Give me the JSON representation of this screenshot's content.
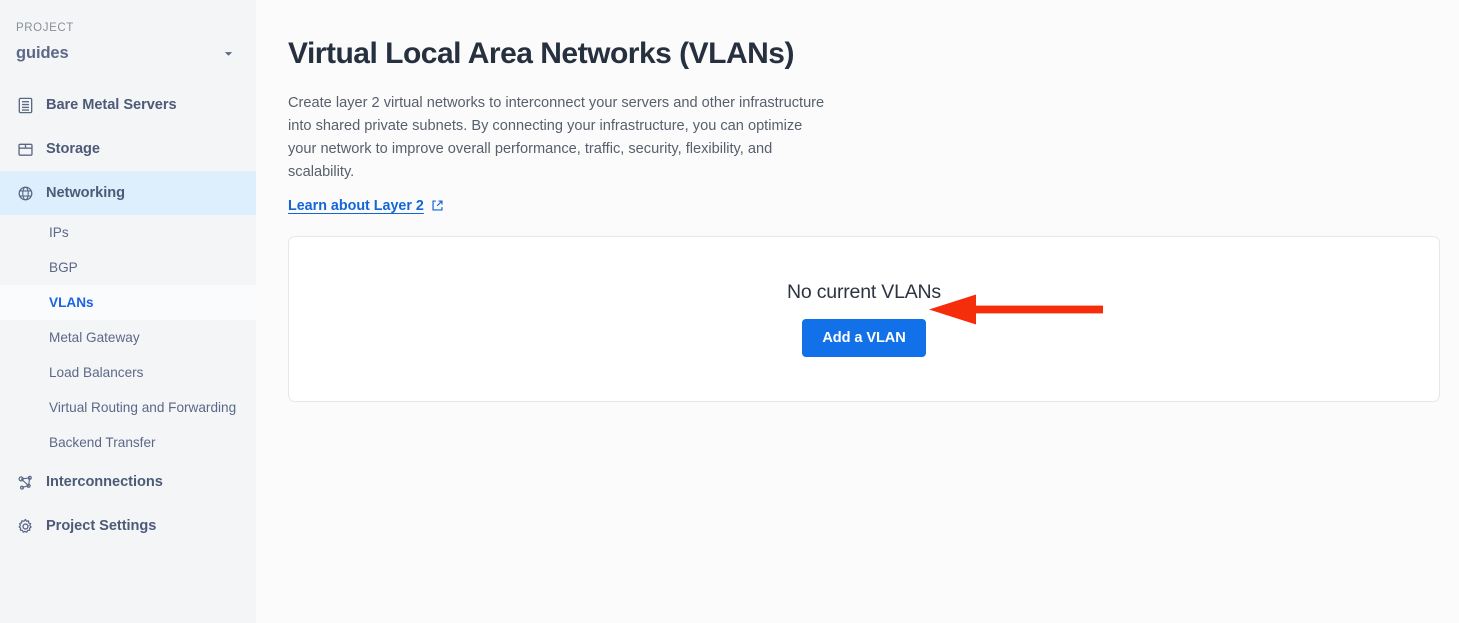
{
  "sidebar": {
    "project_label": "PROJECT",
    "project_name": "guides",
    "caret_icon": "chevron-down-icon",
    "items": [
      {
        "label": "Bare Metal Servers",
        "icon": "server-list-icon",
        "active": false
      },
      {
        "label": "Storage",
        "icon": "box-icon",
        "active": false
      },
      {
        "label": "Networking",
        "icon": "globe-icon",
        "active": true
      },
      {
        "label": "Interconnections",
        "icon": "network-nodes-icon",
        "active": false
      },
      {
        "label": "Project Settings",
        "icon": "gear-icon",
        "active": false
      }
    ],
    "networking_subitems": [
      {
        "label": "IPs",
        "active": false
      },
      {
        "label": "BGP",
        "active": false
      },
      {
        "label": "VLANs",
        "active": true
      },
      {
        "label": "Metal Gateway",
        "active": false
      },
      {
        "label": "Load Balancers",
        "active": false
      },
      {
        "label": "Virtual Routing and Forwarding",
        "active": false
      },
      {
        "label": "Backend Transfer",
        "active": false
      }
    ]
  },
  "main": {
    "title": "Virtual Local Area Networks (VLANs)",
    "description": "Create layer 2 virtual networks to interconnect your servers and other infrastructure into shared private subnets. By connecting your infrastructure, you can optimize your network to improve overall performance, traffic, security, flexibility, and scalability.",
    "learn_link_text": "Learn about Layer 2",
    "learn_link_icon": "external-link-icon",
    "empty_state": {
      "title": "No current VLANs",
      "button_label": "Add a VLAN"
    }
  },
  "annotation": {
    "type": "arrow",
    "direction": "left",
    "points_to": "Add a VLAN",
    "color": "#f62d0a"
  },
  "colors": {
    "page_background": "#fbfbfb",
    "sidebar_background": "#f4f5f7",
    "active_nav_background": "#ddeefc",
    "primary_button": "#1270e8",
    "link": "#1466d6",
    "annotation_arrow": "#f62d0a",
    "card_border": "#e6e7eb"
  }
}
